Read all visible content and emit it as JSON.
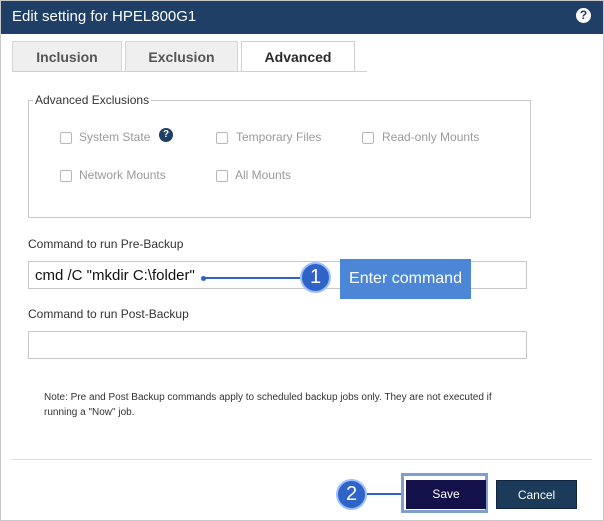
{
  "dialog": {
    "title": "Edit setting for HPEL800G1",
    "help_glyph": "?"
  },
  "tabs": [
    {
      "label": "Inclusion",
      "active": false
    },
    {
      "label": "Exclusion",
      "active": false
    },
    {
      "label": "Advanced",
      "active": true
    }
  ],
  "advanced_exclusions": {
    "legend": "Advanced Exclusions",
    "help_glyph": "?",
    "options": [
      {
        "label": "System State",
        "checked": false
      },
      {
        "label": "Temporary Files",
        "checked": false
      },
      {
        "label": "Read-only Mounts",
        "checked": false
      },
      {
        "label": "Network Mounts",
        "checked": false
      },
      {
        "label": "All Mounts",
        "checked": false
      }
    ]
  },
  "pre_backup": {
    "label": "Command to run Pre-Backup",
    "value": "cmd /C \"mkdir C:\\folder\""
  },
  "post_backup": {
    "label": "Command to run Post-Backup",
    "value": ""
  },
  "note": "Note: Pre and Post Backup commands apply to scheduled backup jobs only. They are not executed if running a \"Now\" job.",
  "buttons": {
    "save": "Save",
    "cancel": "Cancel"
  },
  "annotations": [
    {
      "number": "1",
      "text": "Enter command"
    },
    {
      "number": "2"
    }
  ],
  "colors": {
    "titlebar": "#1f3f66",
    "save_button": "#14104a",
    "cancel_button": "#1c3a5a",
    "callout": "#4c86d6",
    "badge": "#2f63c8"
  }
}
